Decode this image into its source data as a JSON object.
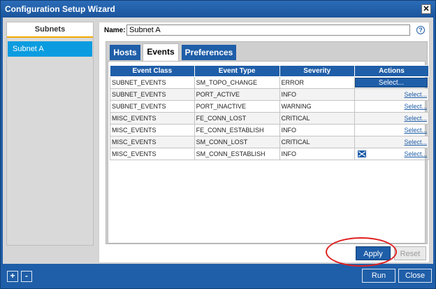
{
  "window": {
    "title": "Configuration Setup Wizard",
    "close_glyph": "✕"
  },
  "sidebar": {
    "header": "Subnets",
    "items": [
      {
        "label": "Subnet A",
        "selected": true
      }
    ]
  },
  "name_field": {
    "label": "Name:",
    "value": "Subnet A"
  },
  "help_glyph": "?",
  "tabs": [
    {
      "label": "Hosts",
      "active": false
    },
    {
      "label": "Events",
      "active": true
    },
    {
      "label": "Preferences",
      "active": false
    }
  ],
  "table": {
    "headers": [
      "Event Class",
      "Event Type",
      "Severity",
      "Actions"
    ],
    "rows": [
      {
        "event_class": "SUBNET_EVENTS",
        "event_type": "SM_TOPO_CHANGE",
        "severity": "ERROR",
        "action": "Select..."
      },
      {
        "event_class": "SUBNET_EVENTS",
        "event_type": "PORT_ACTIVE",
        "severity": "INFO",
        "action": "Select..."
      },
      {
        "event_class": "SUBNET_EVENTS",
        "event_type": "PORT_INACTIVE",
        "severity": "WARNING",
        "action": "Select..."
      },
      {
        "event_class": "MISC_EVENTS",
        "event_type": "FE_CONN_LOST",
        "severity": "CRITICAL",
        "action": "Select..."
      },
      {
        "event_class": "MISC_EVENTS",
        "event_type": "FE_CONN_ESTABLISH",
        "severity": "INFO",
        "action": "Select..."
      },
      {
        "event_class": "MISC_EVENTS",
        "event_type": "SM_CONN_LOST",
        "severity": "CRITICAL",
        "action": "Select..."
      },
      {
        "event_class": "MISC_EVENTS",
        "event_type": "SM_CONN_ESTABLISH",
        "severity": "INFO",
        "action": "Select..."
      }
    ]
  },
  "buttons": {
    "apply": "Apply",
    "reset": "Reset",
    "add": "+",
    "remove": "-",
    "run": "Run",
    "close": "Close"
  },
  "colors": {
    "accent": "#1f5ea8",
    "selection": "#0b9ce0",
    "highlight": "#e02020"
  }
}
